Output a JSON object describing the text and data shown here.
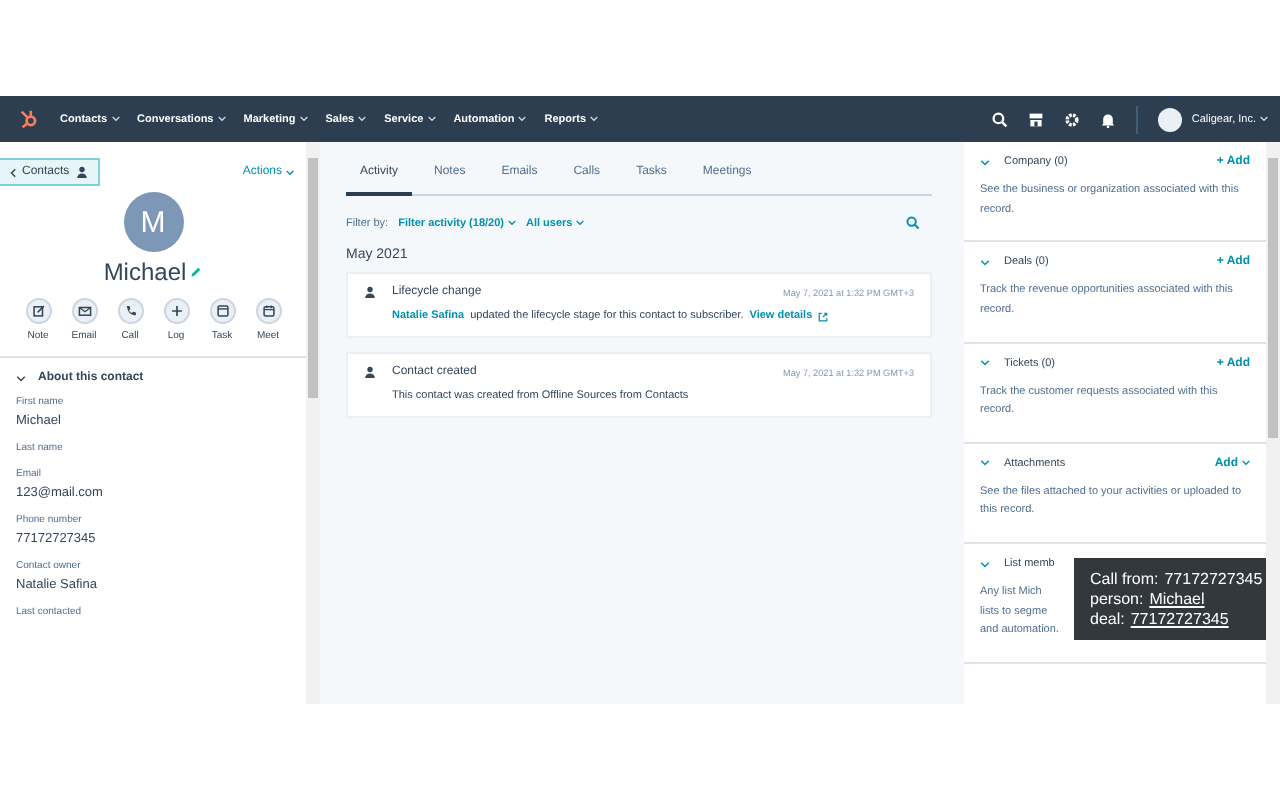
{
  "nav": {
    "items": [
      "Contacts",
      "Conversations",
      "Marketing",
      "Sales",
      "Service",
      "Automation",
      "Reports"
    ],
    "account": "Caligear, Inc."
  },
  "contact": {
    "back": "Contacts",
    "actions": "Actions",
    "initial": "M",
    "name": "Michael",
    "quick_actions": [
      {
        "kind": "note",
        "label": "Note"
      },
      {
        "kind": "email",
        "label": "Email"
      },
      {
        "kind": "call",
        "label": "Call"
      },
      {
        "kind": "log",
        "label": "Log"
      },
      {
        "kind": "task",
        "label": "Task"
      },
      {
        "kind": "meet",
        "label": "Meet"
      }
    ],
    "section": "About this contact",
    "fields": [
      {
        "label": "First name",
        "value": "Michael"
      },
      {
        "label": "Last name"
      },
      {
        "label": "Email",
        "value": "123@mail.com"
      },
      {
        "label": "Phone number",
        "value": "77172727345"
      },
      {
        "label": "Contact owner",
        "value": "Natalie Safina"
      },
      {
        "label": "Last contacted"
      }
    ]
  },
  "activity": {
    "tabs": [
      {
        "label": "Activity",
        "selected": true
      },
      {
        "label": "Notes",
        "selected": false
      },
      {
        "label": "Emails",
        "selected": false
      },
      {
        "label": "Calls",
        "selected": false
      },
      {
        "label": "Tasks",
        "selected": false
      },
      {
        "label": "Meetings",
        "selected": false
      }
    ],
    "filter_label": "Filter by:",
    "filters": [
      "Filter activity (18/20)",
      "All users"
    ],
    "month": "May 2021",
    "events": [
      {
        "title": "Lifecycle change",
        "time": "May 7, 2021 at 1:32 PM GMT+3",
        "actor": "Natalie Safina",
        "text": "updated the lifecycle stage for this contact to subscriber.",
        "link": "View details"
      },
      {
        "title": "Contact created",
        "time": "May 7, 2021 at 1:32 PM GMT+3",
        "text": "This contact was created from Offline Sources from Contacts"
      }
    ]
  },
  "sidebar": {
    "cards": [
      {
        "title": "Company (0)",
        "action": "+ Add",
        "kind": "add",
        "text": "See the business or organization associated with this record."
      },
      {
        "title": "Deals (0)",
        "action": "+ Add",
        "kind": "add",
        "text": "Track the revenue opportunities associated with this record."
      },
      {
        "title": "Tickets (0)",
        "action": "+ Add",
        "kind": "add",
        "text": "Track the customer requests associated with this record."
      },
      {
        "title": "Attachments",
        "action": "Add",
        "kind": "dropdown",
        "text": "See the files attached to your activities or uploaded to this record."
      }
    ],
    "partial": {
      "title": "List memb",
      "lines": [
        "Any list Mich",
        "lists to segme",
        "and automation."
      ]
    }
  },
  "tooltip": {
    "lines": [
      {
        "label": "Call from:",
        "value": "77172727345",
        "link": false
      },
      {
        "label": "person:",
        "value": "Michael",
        "link": true
      },
      {
        "label": "deal:",
        "value": "77172727345",
        "link": true
      }
    ]
  }
}
